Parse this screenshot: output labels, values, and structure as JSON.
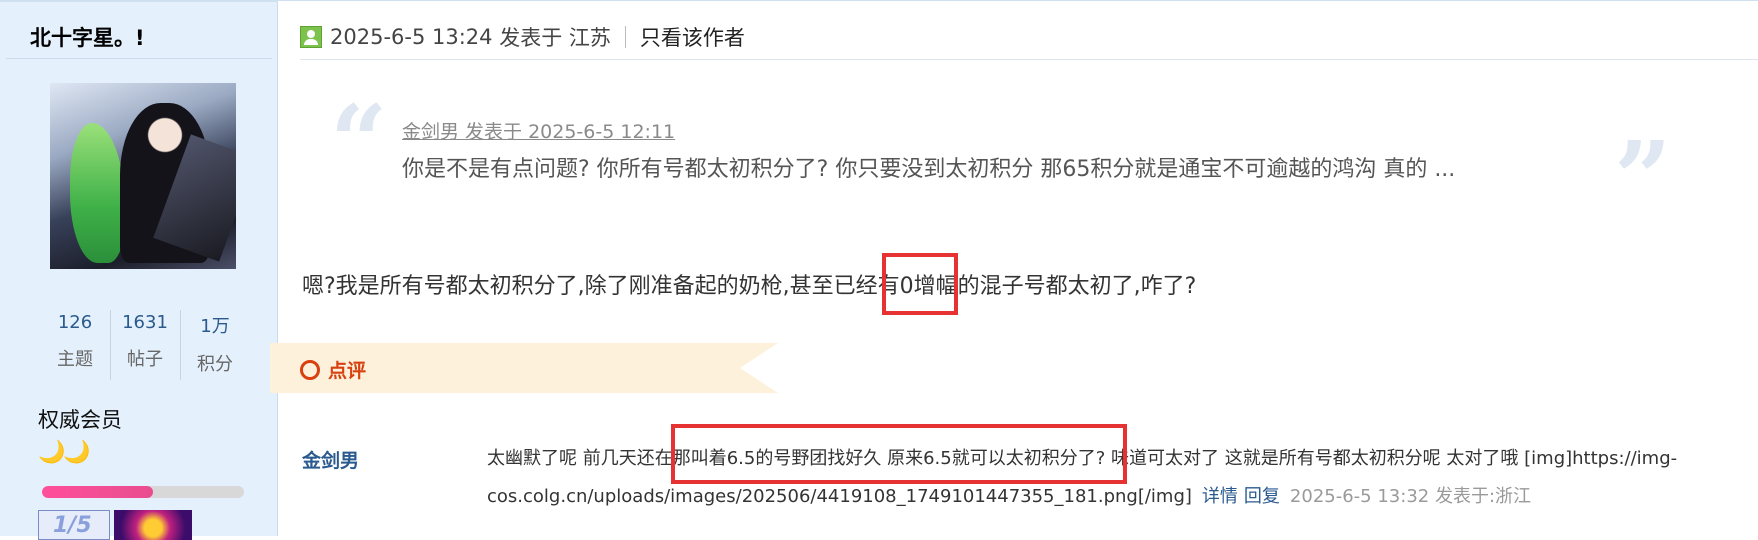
{
  "sidebar": {
    "username": "北十字星。!",
    "stats": [
      {
        "value": "126",
        "label": "主题"
      },
      {
        "value": "1631",
        "label": "帖子"
      },
      {
        "value": "1万",
        "label": "积分"
      }
    ],
    "rank": "权威会员",
    "moons": "🌙🌙",
    "level_progress": 0.55
  },
  "post": {
    "date": "2025-6-5 13:24",
    "posted_at_label": "发表于",
    "location": "江苏",
    "only_author_link": "只看该作者",
    "quote": {
      "meta": "金剑男 发表于 2025-6-5 12:11",
      "text": "你是不是有点问题?  你所有号都太初积分了?  你只要没到太初积分 那65积分就是通宝不可逾越的鸿沟 真的 ..."
    },
    "body": "嗯?我是所有号都太初积分了,除了刚准备起的奶枪,甚至已经有0增幅的混子号都太初了,咋了?"
  },
  "comments": {
    "header": "点评",
    "items": [
      {
        "author": "金剑男",
        "text_line1": "太幽默了呢 前几天还在那叫着6.5的号野团找好久 原来6.5就可以太初积分了?  味道可太对了 这就是所有号都太初积分呢 太对了哦 [img]https://img-",
        "text_line2": "cos.colg.cn/uploads/images/202506/4419108_1749101447355_181.png[/img]",
        "details_link": "详情",
        "reply_link": "回复",
        "timestamp": "2025-6-5 13:32 发表于:浙江"
      }
    ]
  },
  "colors": {
    "accent_blue": "#2a5a8e",
    "highlight_red": "#e63232",
    "comment_orange": "#d84010",
    "sidebar_bg": "#e4f0fb"
  }
}
